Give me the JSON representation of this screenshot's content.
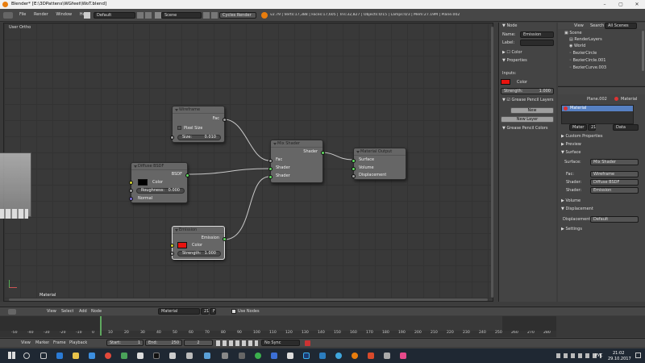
{
  "window": {
    "title": "Blender* [E:\\3DPattens\\WGfeet\\WoT.blend]"
  },
  "topbar": {
    "menus": [
      "File",
      "Render",
      "Window",
      "Help"
    ],
    "layout": "Default",
    "scene": "Scene",
    "engine": "Cycles Render",
    "stats": "v2.79 | Verts:17,388 | Faces:17,605 | Tris:32,827 | Objects:0/15 | Lamps:0/3 | Mem:27.19M | Plane.002"
  },
  "viewport": {
    "label": "User Ortho"
  },
  "node_editor": {
    "material_label": "Material",
    "nodes": {
      "wireframe": {
        "title": "Wireframe",
        "out_fac": "Fac",
        "pixel_size": "Pixel Size",
        "size_label": "Size:",
        "size_value": "0.010"
      },
      "diffuse": {
        "title": "Diffuse BSDF",
        "out": "BSDF",
        "color": "Color",
        "roughness_label": "Roughness:",
        "roughness_value": "0.000",
        "normal": "Normal"
      },
      "mix": {
        "title": "Mix Shader",
        "out": "Shader",
        "fac": "Fac",
        "shader1": "Shader",
        "shader2": "Shader"
      },
      "output": {
        "title": "Material Output",
        "surface": "Surface",
        "volume": "Volume",
        "displacement": "Displacement"
      },
      "emission": {
        "title": "Emission",
        "out": "Emission",
        "color": "Color",
        "strength_label": "Strength:",
        "strength_value": "1.000"
      }
    }
  },
  "node_header": {
    "menus": [
      "View",
      "Select",
      "Add",
      "Node"
    ],
    "material": "Material",
    "users": "21",
    "fake": "F",
    "use_nodes": "Use Nodes"
  },
  "node_sidebar": {
    "node_section": "Node",
    "name_label": "Name:",
    "name_value": "Emission",
    "label_label": "Label:",
    "color_section": "Color",
    "properties_section": "Properties",
    "inputs": "Inputs:",
    "color_label": "Color",
    "strength_label": "Strength:",
    "strength_value": "1.000",
    "gp_section": "Grease Pencil Layers",
    "new": "New",
    "new_layer": "New Layer",
    "gp_colors": "Grease Pencil Colors"
  },
  "outliner": {
    "tabs": [
      "View",
      "Search",
      "All Scenes"
    ],
    "items": [
      "Scene",
      "RenderLayers",
      "World",
      "BezierCircle",
      "BezierCircle.001",
      "BezierCurve.003"
    ]
  },
  "properties": {
    "object": "Plane.002",
    "material": "Material",
    "slot": "Material",
    "mat_name": "Mater",
    "mat_users": "21",
    "mode": "Data",
    "sections": [
      "Custom Properties",
      "Preview",
      "Surface",
      "Volume",
      "Displacement",
      "Settings"
    ],
    "surface_label": "Surface:",
    "surface_value": "Mix Shader",
    "fac_label": "Fac:",
    "fac_value": "Wireframe",
    "shader1_label": "Shader:",
    "shader1_value": "Diffuse BSDF",
    "shader2_label": "Shader:",
    "shader2_value": "Emission",
    "displacement_label": "Displacement:",
    "displacement_value": "Default"
  },
  "timeline": {
    "ticks": [
      "-50",
      "-40",
      "-30",
      "-20",
      "-10",
      "0",
      "10",
      "20",
      "30",
      "40",
      "50",
      "60",
      "70",
      "80",
      "90",
      "100",
      "110",
      "120",
      "130",
      "140",
      "150",
      "160",
      "170",
      "180",
      "190",
      "200",
      "210",
      "220",
      "230",
      "240",
      "250",
      "260",
      "270",
      "280"
    ],
    "menus": [
      "View",
      "Marker",
      "Frame",
      "Playback"
    ],
    "start_label": "Start:",
    "start_value": "1",
    "end_label": "End:",
    "end_value": "250",
    "current": "2",
    "sync": "No Sync"
  },
  "taskbar": {
    "lang": "РУС",
    "time": "21:02",
    "date": "29.10.2017"
  },
  "colors": {
    "emission_red": "#e8130f",
    "diffuse_black": "#000000",
    "socket_green": "#5fdc5f",
    "socket_yellow": "#d6d62f",
    "socket_gray": "#a0a0a0",
    "link_color": "#c8c8c8"
  }
}
